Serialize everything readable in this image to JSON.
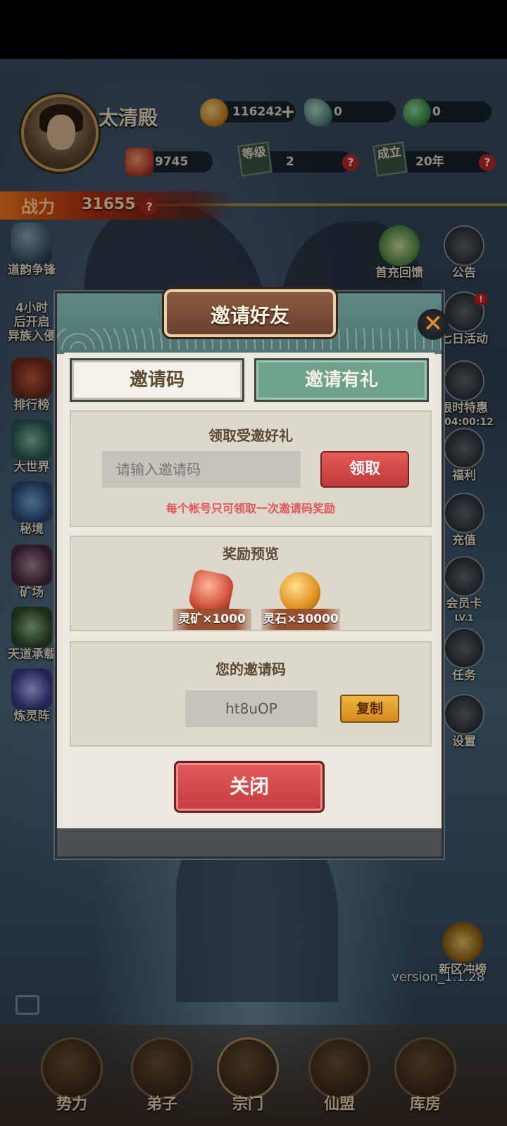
{
  "hud": {
    "sect_name": "太清殿",
    "gold": "116242",
    "plus": "+",
    "crystal": "0",
    "leaf": "0",
    "ore": "9745",
    "level_stamp": "等级",
    "level": "2",
    "founded_stamp": "成立",
    "founded": "20年",
    "help": "?",
    "power_label": "战力",
    "power": "31655"
  },
  "left_menu": [
    {
      "label": "道韵争锋"
    },
    {
      "label": "4小时后开启",
      "label2": "异族入侵"
    },
    {
      "label": "排行榜"
    },
    {
      "label": "大世界"
    },
    {
      "label": "秘境"
    },
    {
      "label": "矿场"
    },
    {
      "label": "天道承载"
    },
    {
      "label": "炼灵阵"
    }
  ],
  "right_menu": [
    {
      "label": "首充回馈"
    },
    {
      "label": "公告"
    },
    {
      "label": "七日活动"
    },
    {
      "label": "限时特惠",
      "timer": "天04:00:12"
    },
    {
      "label": "福利"
    },
    {
      "label": "充值"
    },
    {
      "label": "会员卡",
      "sub": "LV.1"
    },
    {
      "label": "任务"
    },
    {
      "label": "设置"
    },
    {
      "label": "新区冲榜"
    }
  ],
  "version": "version_1.1.28",
  "bottom_nav": [
    {
      "label": "势力"
    },
    {
      "label": "弟子"
    },
    {
      "label": "宗门"
    },
    {
      "label": "仙盟"
    },
    {
      "label": "库房"
    }
  ],
  "modal": {
    "title": "邀请好友",
    "close_x": "✕",
    "tabs": [
      {
        "label": "邀请码",
        "active": true
      },
      {
        "label": "邀请有礼",
        "active": false
      }
    ],
    "redeem": {
      "title": "领取受邀好礼",
      "placeholder": "请输入邀请码",
      "claim_button": "领取",
      "note": "每个帐号只可领取一次邀请码奖励"
    },
    "rewards": {
      "title": "奖励预览",
      "items": [
        {
          "label": "灵矿×1000",
          "icon": "ore-icon"
        },
        {
          "label": "灵石×30000",
          "icon": "spirit-stone-icon"
        }
      ]
    },
    "my_code": {
      "title": "您的邀请码",
      "code": "ht8uOP",
      "copy_button": "复制"
    },
    "close_button": "关闭"
  }
}
